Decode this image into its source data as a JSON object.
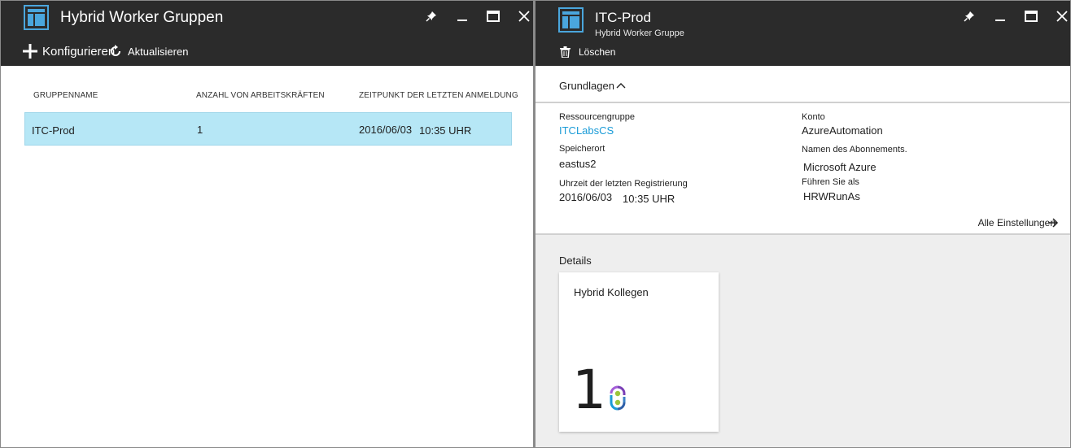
{
  "left_blade": {
    "title": "Hybrid Worker Gruppen",
    "commands": {
      "configure_label": "Konfigurieren",
      "refresh_label": "Aktualisieren"
    },
    "grid": {
      "columns": [
        "GRUPPENNAME",
        "ANZAHL VON ARBEITSKRÄFTEN",
        "ZEITPUNKT DER LETZTEN ANMELDUNG"
      ],
      "rows": [
        {
          "name": "ITC-Prod",
          "count": "1",
          "date": "2016/06/03",
          "time": "10:35 UHR"
        }
      ]
    }
  },
  "right_blade": {
    "title": "ITC-Prod",
    "subtitle": "Hybrid Worker Gruppe",
    "commands": {
      "delete_label": "Löschen"
    },
    "essentials": {
      "toggle_label": "Grundlagen",
      "resource_group_label": "Ressourcengruppe",
      "resource_group_value": "ITCLabsCS",
      "location_label": "Speicherort",
      "location_value": "eastus2",
      "last_reg_label": "Uhrzeit der letzten Registrierung",
      "last_reg_date": "2016/06/03",
      "last_reg_time": "10:35 UHR",
      "account_label": "Konto",
      "account_value": "AzureAutomation",
      "subscription_label": "Namen des Abonnements.",
      "subscription_value": "Microsoft Azure",
      "run_as_label": "Führen Sie als",
      "run_as_value": "HRWRunAs",
      "all_settings_label": "Alle Einstellungen"
    },
    "details": {
      "label": "Details",
      "tile_title": "Hybrid Kollegen",
      "tile_count": "1"
    }
  },
  "icons": {
    "blade_icon": "blade-icon",
    "pin": "pin-icon",
    "minimize": "minimize-icon",
    "maximize": "maximize-icon",
    "close": "close-icon",
    "add": "plus-icon",
    "refresh": "refresh-icon",
    "delete": "trash-icon",
    "collapse": "chevron-up-icon",
    "arrow": "arrow-right-icon",
    "hybrid_worker": "hybrid-worker-icon"
  },
  "colors": {
    "header_bg": "#2b2b2b",
    "selected_row": "#b6e7f6",
    "link": "#1a9bd7",
    "details_bg": "#eeeeee",
    "icon_blue": "#4aa6dd"
  }
}
